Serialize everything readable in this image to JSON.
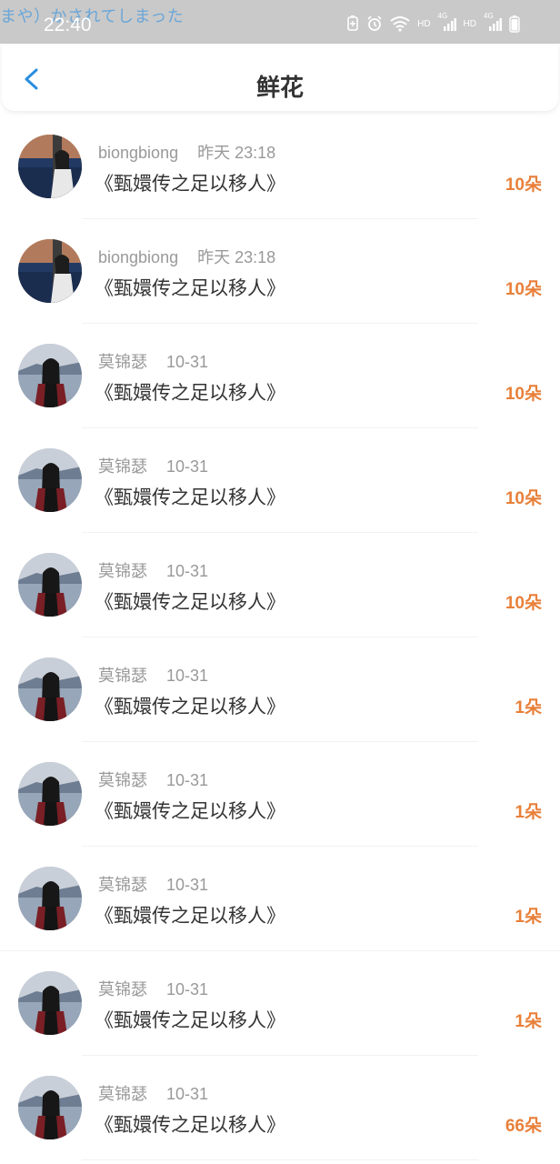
{
  "status_bar": {
    "ticker": "まや）かされてしまった",
    "time": "22:40",
    "hd1": "HD",
    "net1": "4G",
    "hd2": "HD",
    "net2": "4G"
  },
  "header": {
    "title": "鲜花"
  },
  "rows": [
    {
      "user": "biongbiong",
      "time": "昨天 23:18",
      "book": "《甄嬛传之足以移人》",
      "amount": "10朵",
      "avatar": "avatar-a"
    },
    {
      "user": "biongbiong",
      "time": "昨天 23:18",
      "book": "《甄嬛传之足以移人》",
      "amount": "10朵",
      "avatar": "avatar-a"
    },
    {
      "user": "莫锦瑟",
      "time": "10-31",
      "book": "《甄嬛传之足以移人》",
      "amount": "10朵",
      "avatar": "avatar-b"
    },
    {
      "user": "莫锦瑟",
      "time": "10-31",
      "book": "《甄嬛传之足以移人》",
      "amount": "10朵",
      "avatar": "avatar-b"
    },
    {
      "user": "莫锦瑟",
      "time": "10-31",
      "book": "《甄嬛传之足以移人》",
      "amount": "10朵",
      "avatar": "avatar-b"
    },
    {
      "user": "莫锦瑟",
      "time": "10-31",
      "book": "《甄嬛传之足以移人》",
      "amount": "1朵",
      "avatar": "avatar-b"
    },
    {
      "user": "莫锦瑟",
      "time": "10-31",
      "book": "《甄嬛传之足以移人》",
      "amount": "1朵",
      "avatar": "avatar-b"
    },
    {
      "user": "莫锦瑟",
      "time": "10-31",
      "book": "《甄嬛传之足以移人》",
      "amount": "1朵",
      "avatar": "avatar-b"
    },
    {
      "user": "莫锦瑟",
      "time": "10-31",
      "book": "《甄嬛传之足以移人》",
      "amount": "1朵",
      "avatar": "avatar-b"
    },
    {
      "user": "莫锦瑟",
      "time": "10-31",
      "book": "《甄嬛传之足以移人》",
      "amount": "66朵",
      "avatar": "avatar-b"
    }
  ],
  "colors": {
    "accent": "#e8803a",
    "back": "#2a8ee0",
    "title": "#333333",
    "meta": "#999999"
  }
}
